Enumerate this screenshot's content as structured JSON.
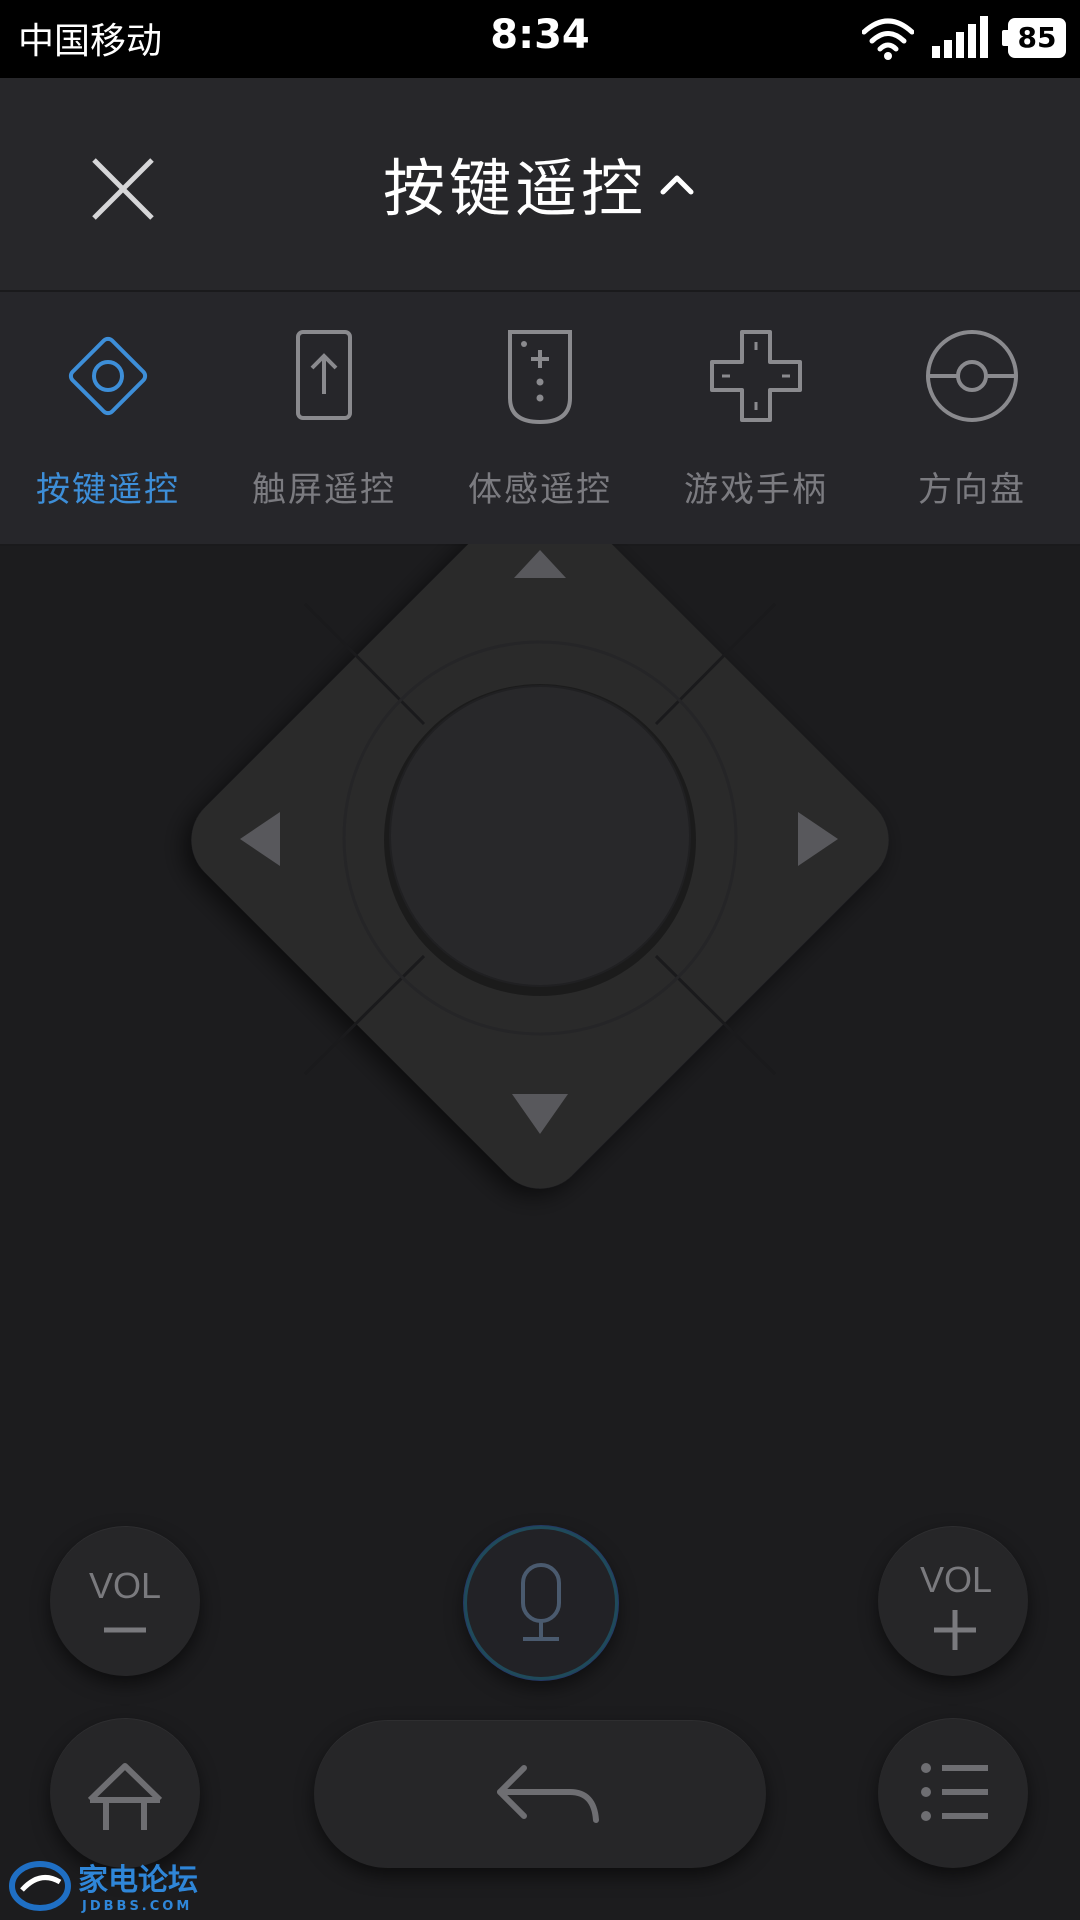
{
  "status_bar": {
    "carrier": "中国移动",
    "time": "8:34",
    "battery": "85"
  },
  "header": {
    "title": "按键遥控",
    "close_icon": "close-icon",
    "toggle_icon": "chevron-up-icon"
  },
  "mode_tabs": [
    {
      "label": "按键遥控",
      "icon": "diamond-icon",
      "active": true
    },
    {
      "label": "触屏遥控",
      "icon": "touch-upload-icon",
      "active": false
    },
    {
      "label": "体感遥控",
      "icon": "remote-icon",
      "active": false
    },
    {
      "label": "游戏手柄",
      "icon": "gamepad-cross-icon",
      "active": false
    },
    {
      "label": "方向盘",
      "icon": "steering-wheel-icon",
      "active": false
    }
  ],
  "controls": {
    "vol_minus": "VOL",
    "vol_plus": "VOL",
    "mic_icon": "microphone-icon",
    "home_icon": "home-icon",
    "back_icon": "back-arrow-icon",
    "menu_icon": "menu-list-icon"
  },
  "watermark": {
    "logo_text": "家电论坛",
    "site": "JDBBS.COM"
  },
  "colors": {
    "accent": "#3d8ed8",
    "background": "#1c1c1e",
    "header": "#27272a",
    "inactive_text": "#7b7b80"
  }
}
